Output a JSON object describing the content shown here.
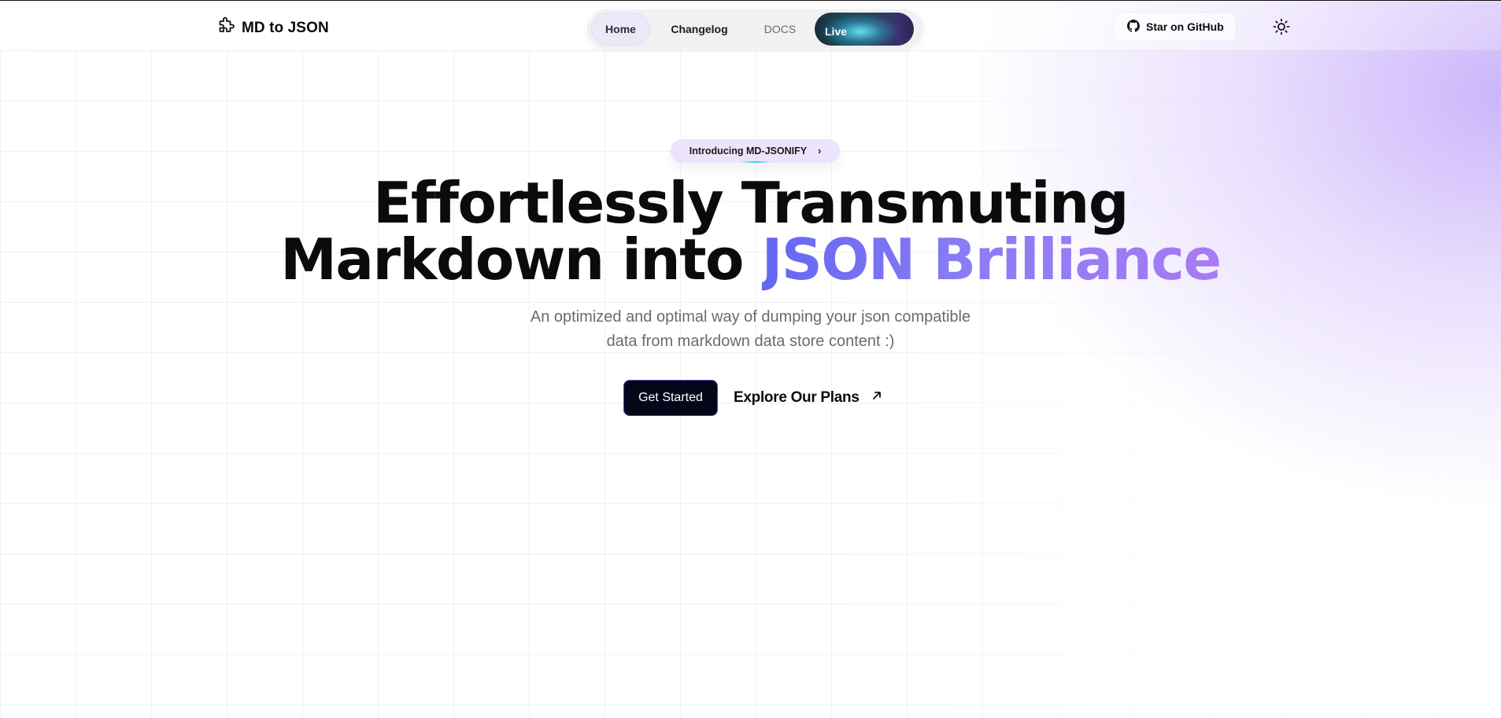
{
  "header": {
    "logo_text": "MD to JSON",
    "logo_icon": "puzzle-icon",
    "nav": {
      "home": "Home",
      "changelog": "Changelog",
      "docs": "DOCS",
      "live": "Live"
    },
    "github_label": "Star on GitHub",
    "github_icon": "github-icon",
    "theme_icon": "sun-icon"
  },
  "hero": {
    "badge_label": "Introducing MD-JSONIFY",
    "badge_chevron": "›",
    "headline_line1": "Effortlessly Transmuting",
    "headline_line2_plain": "Markdown into",
    "headline_line2_accent": "JSON Brilliance",
    "subtitle": "An optimized and optimal way of dumping your json compatible data from markdown data store content :)",
    "cta_primary": "Get Started",
    "cta_secondary": "Explore Our Plans",
    "cta_secondary_icon": "arrow-up-right-icon"
  },
  "colors": {
    "accent_start": "#6366f1",
    "accent_end": "#a77bf3",
    "primary_button": "#06061a",
    "corner_glow": "#c4a8fa"
  }
}
